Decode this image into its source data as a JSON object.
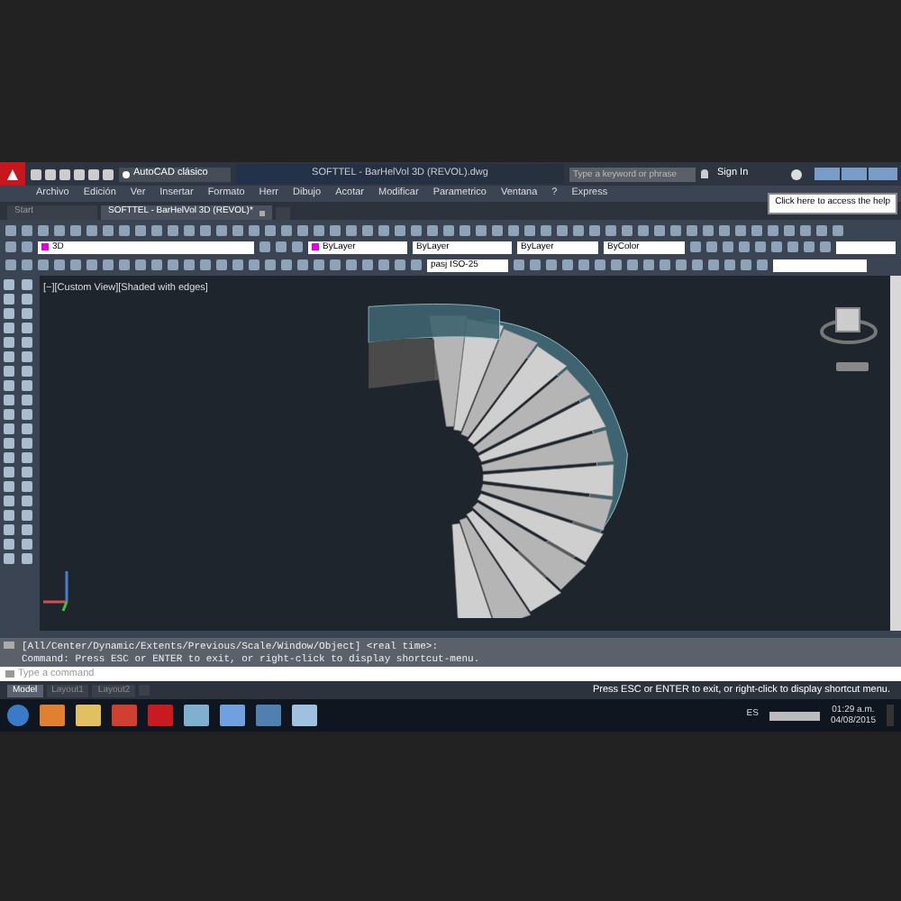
{
  "title_bar": {
    "workspace": "AutoCAD clásico",
    "title": "SOFTTEL - BarHelVol 3D (REVOL).dwg",
    "search": {
      "placeholder": "Type a keyword or phrase"
    },
    "sign_in": "Sign In"
  },
  "menu_bar": [
    "Archivo",
    "Edición",
    "Ver",
    "Insertar",
    "Formato",
    "Herr",
    "Dibujo",
    "Acotar",
    "Modificar",
    "Parametrico",
    "Ventana",
    "?",
    "Express"
  ],
  "tooltip": "Click here to access the help",
  "file_tabs": [
    {
      "label": "Start",
      "selected": false
    },
    {
      "label": "SOFTTEL - BarHelVol 3D (REVOL)*",
      "selected": true
    }
  ],
  "properties_bar": {
    "layer": "3D",
    "color_control": "ByLayer",
    "linetype": "ByLayer",
    "lineweight": "ByLayer",
    "plot_style": "ByColor"
  },
  "dim_style": "pasj ISO-25",
  "viewport": {
    "label": "[−][Custom View][Shaded with edges]"
  },
  "command_history": [
    "[All/Center/Dynamic/Extents/Previous/Scale/Window/Object] <real time>:",
    "Command:  Press ESC or ENTER to exit, or right-click to display shortcut-menu."
  ],
  "command_line": {
    "placeholder": "Type a command"
  },
  "layout_tabs": [
    {
      "label": "Model",
      "selected": true
    },
    {
      "label": "Layout1",
      "selected": false
    },
    {
      "label": "Layout2",
      "selected": false
    }
  ],
  "status_message": "Press ESC or ENTER to exit, or right-click to display shortcut menu.",
  "taskbar": {
    "language": "ES",
    "time": "01:29 a.m.",
    "date": "04/08/2015"
  }
}
